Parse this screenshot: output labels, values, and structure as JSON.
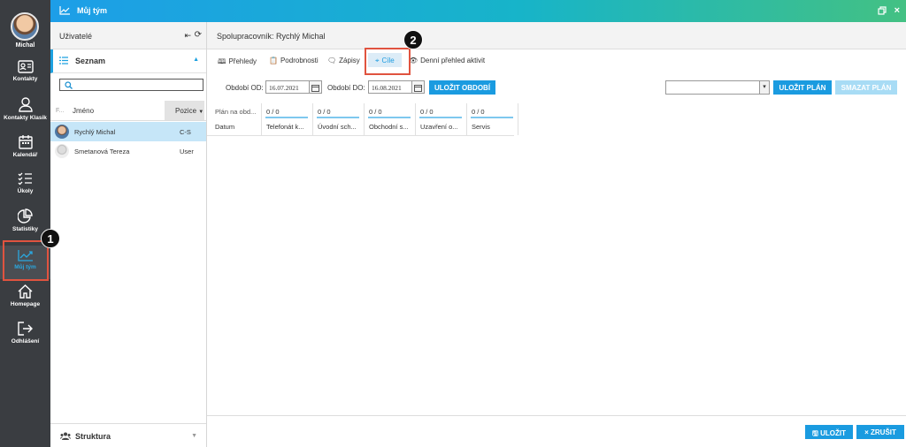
{
  "nav": {
    "user_name": "Michal",
    "items": [
      {
        "label": "Kontakty",
        "icon": "contact-card-icon"
      },
      {
        "label": "Kontakty Klasik",
        "icon": "person-icon"
      },
      {
        "label": "Kalendář",
        "icon": "calendar-icon"
      },
      {
        "label": "Úkoly",
        "icon": "checklist-icon"
      },
      {
        "label": "Statistiky",
        "icon": "pie-chart-icon"
      },
      {
        "label": "Můj tým",
        "icon": "trend-chart-icon"
      },
      {
        "label": "Homepage",
        "icon": "home-icon"
      },
      {
        "label": "Odhlášení",
        "icon": "logout-icon"
      }
    ]
  },
  "header": {
    "title": "Můj tým"
  },
  "users_panel": {
    "title": "Uživatelé",
    "section_list": "Seznam",
    "search_placeholder": "",
    "columns": {
      "f": "F...",
      "name": "Jméno",
      "position": "Pozice"
    },
    "rows": [
      {
        "name": "Rychlý Michal",
        "role": "C-S"
      },
      {
        "name": "Smetanová Tereza",
        "role": "User"
      }
    ],
    "section_structure": "Struktura"
  },
  "main": {
    "title": "Spolupracovník: Rychlý Michal",
    "tabs": [
      "Přehledy",
      "Podrobnosti",
      "Zápisy",
      "Cíle",
      "Denní přehled aktivit"
    ],
    "filters": {
      "from_label": "Období OD:",
      "from_value": "16.07.2021",
      "to_label": "Období DO:",
      "to_value": "16.08.2021",
      "save_period": "ULOŽIT OBDOBÍ",
      "save_plan": "ULOŽIT PLÁN",
      "delete_plan": "SMAZAT PLÁN"
    },
    "grid": [
      {
        "value": "Plán na obd...",
        "header": "Datum"
      },
      {
        "value": "0 / 0",
        "header": "Telefonát k..."
      },
      {
        "value": "0 / 0",
        "header": "Úvodní sch..."
      },
      {
        "value": "0 / 0",
        "header": "Obchodní s..."
      },
      {
        "value": "0 / 0",
        "header": "Uzavření o..."
      },
      {
        "value": "0 / 0",
        "header": "Servis"
      }
    ],
    "buttons": {
      "save": "ULOŽIT",
      "cancel": "ZRUŠIT"
    }
  },
  "annotations": {
    "marker1": "1",
    "marker2": "2"
  },
  "colors": {
    "accent": "#1a9be0",
    "highlight": "#e0533f",
    "nav_bg": "#3a3d41"
  }
}
